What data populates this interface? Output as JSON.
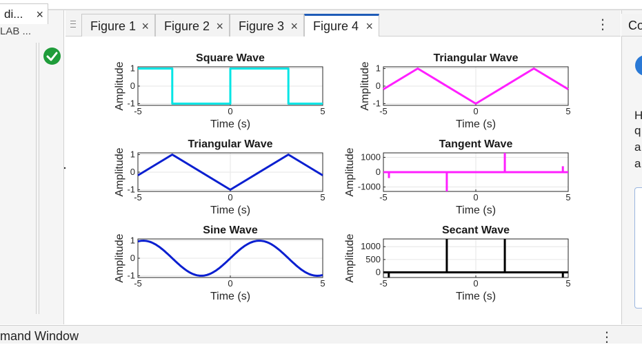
{
  "left_panel": {
    "tab_label": "di...",
    "close_glyph": "×",
    "subtitle": "LAB ...",
    "status_icon": "check-circle-icon",
    "status_color": "#1f9c3a"
  },
  "figure_tabs": [
    {
      "label": "Figure 1",
      "close": "×",
      "active": false
    },
    {
      "label": "Figure 2",
      "close": "×",
      "active": false
    },
    {
      "label": "Figure 3",
      "close": "×",
      "active": false
    },
    {
      "label": "Figure 4",
      "close": "×",
      "active": true
    }
  ],
  "menu_glyph": "⋮",
  "right_panel": {
    "tab_label": "Co",
    "lines": [
      "H",
      "q",
      "a",
      "a"
    ],
    "accent": "#2a79d6"
  },
  "bottom": {
    "title": "mand Window",
    "menu_glyph": "⋮"
  },
  "chart_data": [
    {
      "type": "line",
      "title": "Square Wave",
      "xlabel": "Time (s)",
      "ylabel": "Amplitude",
      "xlim": [
        -5,
        5
      ],
      "ylim": [
        -1.1,
        1.1
      ],
      "xticks": [
        -5,
        0,
        5
      ],
      "yticks": [
        -1,
        0,
        1
      ],
      "ytick_labels": [
        "-1",
        "0",
        "1"
      ],
      "color": "#00e5e5",
      "function": "square",
      "series": [
        {
          "x": [
            -5,
            -3.14,
            -3.14,
            0,
            0,
            3.14,
            3.14,
            5
          ],
          "y": [
            1,
            1,
            -1,
            -1,
            1,
            1,
            -1,
            -1
          ]
        }
      ]
    },
    {
      "type": "line",
      "title": "Triangular Wave",
      "xlabel": "Time (s)",
      "ylabel": "Amplitude",
      "xlim": [
        -5,
        5
      ],
      "ylim": [
        -1.1,
        1.1
      ],
      "xticks": [
        -5,
        0,
        5
      ],
      "yticks": [
        -1,
        0,
        1
      ],
      "ytick_labels": [
        "-1",
        "0",
        "1"
      ],
      "color": "#ff1fff",
      "function": "triangle",
      "series": [
        {
          "x": [
            -5,
            -3.14,
            0,
            3.14,
            5
          ],
          "y": [
            -0.18,
            1,
            -1,
            1,
            -0.18
          ]
        }
      ]
    },
    {
      "type": "line",
      "title": "Triangular Wave",
      "xlabel": "Time (s)",
      "ylabel": "Amplitude",
      "xlim": [
        -5,
        5
      ],
      "ylim": [
        -1.1,
        1.1
      ],
      "xticks": [
        -5,
        0,
        5
      ],
      "yticks": [
        -1,
        0,
        1
      ],
      "ytick_labels": [
        "-1",
        "0",
        "1"
      ],
      "color": "#0a1fd0",
      "function": "triangle",
      "series": [
        {
          "x": [
            -5,
            -3.14,
            0,
            3.14,
            5
          ],
          "y": [
            -0.18,
            1,
            -1,
            1,
            -0.18
          ]
        }
      ]
    },
    {
      "type": "line",
      "title": "Tangent Wave",
      "xlabel": "Time (s)",
      "ylabel": "Amplitude",
      "xlim": [
        -5,
        5
      ],
      "ylim": [
        -1300,
        1300
      ],
      "xticks": [
        -5,
        0,
        5
      ],
      "yticks": [
        -1000,
        0,
        1000
      ],
      "ytick_labels": [
        "-1000",
        "0",
        "1000"
      ],
      "color": "#ff1fff",
      "function": "tangent",
      "spikes": [
        {
          "x": -4.7,
          "y": -400
        },
        {
          "x": -1.57,
          "y": -1300
        },
        {
          "x": 1.57,
          "y": 1300
        },
        {
          "x": 4.71,
          "y": 400
        }
      ]
    },
    {
      "type": "line",
      "title": "Sine Wave",
      "xlabel": "Time (s)",
      "ylabel": "Amplitude",
      "xlim": [
        -5,
        5
      ],
      "ylim": [
        -1.1,
        1.1
      ],
      "xticks": [
        -5,
        0,
        5
      ],
      "yticks": [
        -1,
        0,
        1
      ],
      "ytick_labels": [
        "-1",
        "0",
        "1"
      ],
      "color": "#0a1fd0",
      "function": "sine"
    },
    {
      "type": "line",
      "title": "Secant Wave",
      "xlabel": "Time (s)",
      "ylabel": "Amplitude",
      "xlim": [
        -5,
        5
      ],
      "ylim": [
        -200,
        1300
      ],
      "xticks": [
        -5,
        0,
        5
      ],
      "yticks": [
        0,
        500,
        1000
      ],
      "ytick_labels": [
        "0",
        "500",
        "1000"
      ],
      "color": "#000000",
      "function": "secant",
      "spikes": [
        {
          "x": -4.71,
          "y": -200
        },
        {
          "x": -1.57,
          "y": 1300
        },
        {
          "x": 1.57,
          "y": 1300
        },
        {
          "x": 4.71,
          "y": -200
        }
      ]
    }
  ]
}
